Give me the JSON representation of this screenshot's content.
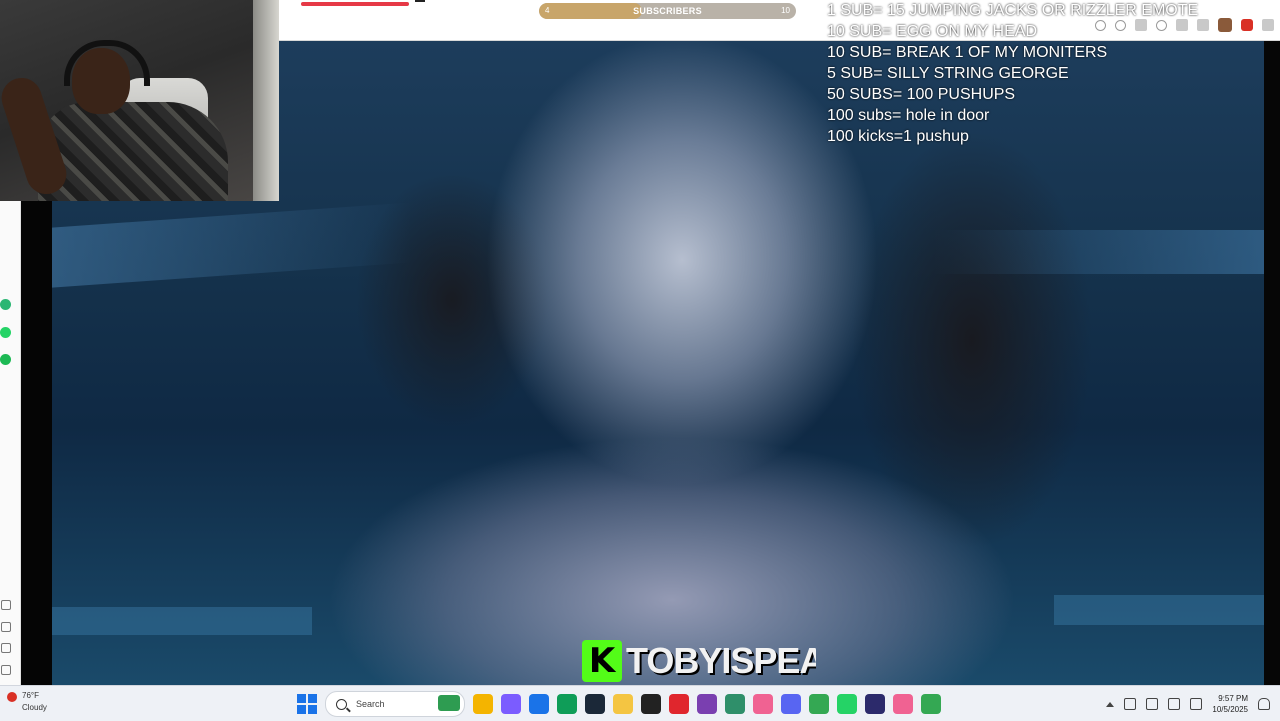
{
  "subscriber_goal": {
    "label": "SUBSCRIBERS",
    "current": "4",
    "max": "10",
    "progress": 0.4,
    "colors": {
      "track": "#b9b2a8",
      "fill": "#c8a56a"
    }
  },
  "goals_overlay": {
    "lines": [
      "1 SUB= 15 JUMPING JACKS OR RIZZLER EMOTE",
      "10 SUB= EGG ON MY HEAD",
      "10 SUB= BREAK 1 OF MY MONITERS",
      "5 SUB= SILLY STRING GEORGE",
      "50 SUBS= 100 PUSHUPS",
      "100 subs= hole in door",
      "100 kicks=1 pushup"
    ]
  },
  "watermark": {
    "logo_letter": "K",
    "channel_name": "TOBYISPEAK",
    "brand_color": "#53fc18"
  },
  "taskbar": {
    "weather": {
      "temperature": "76°F",
      "condition": "Cloudy"
    },
    "search": {
      "placeholder": "Search"
    },
    "apps": [
      {
        "icon": "file-explorer-icon",
        "color": "#f4b400"
      },
      {
        "icon": "copilot-icon",
        "color": "#7b5cff"
      },
      {
        "icon": "microsoft-store-icon",
        "color": "#1a73e8"
      },
      {
        "icon": "edge-icon",
        "color": "#0f9d58"
      },
      {
        "icon": "steam-icon",
        "color": "#1b2838"
      },
      {
        "icon": "folder-icon",
        "color": "#f4c542"
      },
      {
        "icon": "obs-icon",
        "color": "#222222"
      },
      {
        "icon": "opera-icon",
        "color": "#e0262d"
      },
      {
        "icon": "app-purple-icon",
        "color": "#7a3fb0"
      },
      {
        "icon": "game-icon",
        "color": "#2f8f6a"
      },
      {
        "icon": "maps-pin-icon",
        "color": "#f06292"
      },
      {
        "icon": "discord-icon",
        "color": "#5865f2"
      },
      {
        "icon": "chrome-icon",
        "color": "#34a853"
      },
      {
        "icon": "whatsapp-icon",
        "color": "#25d366"
      },
      {
        "icon": "next-app-icon",
        "color": "#2c2a6b"
      },
      {
        "icon": "maps-pin-icon-2",
        "color": "#f06292"
      },
      {
        "icon": "chrome-alt-icon",
        "color": "#34a853"
      }
    ],
    "clock": {
      "time": "9:57 PM",
      "date": "10/5/2025"
    }
  }
}
